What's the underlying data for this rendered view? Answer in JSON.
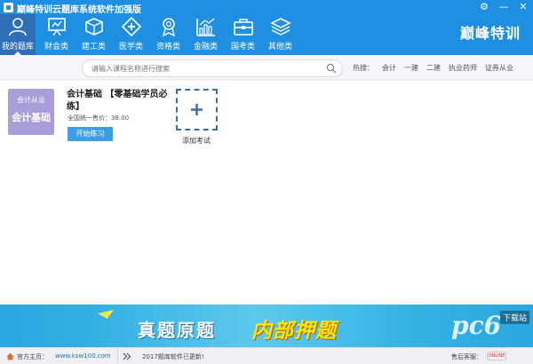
{
  "app": {
    "title": "巅峰特训云题库系统软件加强版"
  },
  "window_controls": {
    "settings": "⚙",
    "minimize": "—",
    "close": "✕"
  },
  "nav": {
    "items": [
      {
        "label": "我的题库",
        "icon": "person-icon",
        "active": true
      },
      {
        "label": "财会类",
        "icon": "presentation-icon",
        "active": false
      },
      {
        "label": "建工类",
        "icon": "cube-icon",
        "active": false
      },
      {
        "label": "医学类",
        "icon": "medical-cross-icon",
        "active": false
      },
      {
        "label": "资格类",
        "icon": "medal-icon",
        "active": false
      },
      {
        "label": "金融类",
        "icon": "bar-chart-icon",
        "active": false
      },
      {
        "label": "国考类",
        "icon": "briefcase-icon",
        "active": false
      },
      {
        "label": "其他类",
        "icon": "layers-icon",
        "active": false
      }
    ],
    "brand": "巅峰特训"
  },
  "search": {
    "placeholder": "请输入课程名称进行搜索",
    "hot_label": "热搜：",
    "hot_items": [
      "会计",
      "一建",
      "二建",
      "执业药师",
      "证券从业"
    ]
  },
  "course": {
    "cover_top": "会计从业",
    "cover_main": "会计基础",
    "title": "会计基础 【零基础学员必练】",
    "price": "全国统一售价：38.00",
    "start_label": "开始练习"
  },
  "add_tile": {
    "label": "添加考试"
  },
  "banner": {
    "part1": "真题原题",
    "part2": "内部押题",
    "watermark": "pc6",
    "watermark_badge": "下载站"
  },
  "statusbar": {
    "home_label": "官方主页：",
    "home_link": "www.ksw100.com",
    "update_msg": "2017题库软件已更新!",
    "service_label": "售后客服：",
    "service_badge": "ONLINE"
  },
  "colors": {
    "header_blue": "#1e8fe1",
    "active_nav": "#2f6fb8",
    "cover_purple": "#a99ed7",
    "start_button": "#3d9ee8",
    "banner_yellow": "#ffe600"
  }
}
